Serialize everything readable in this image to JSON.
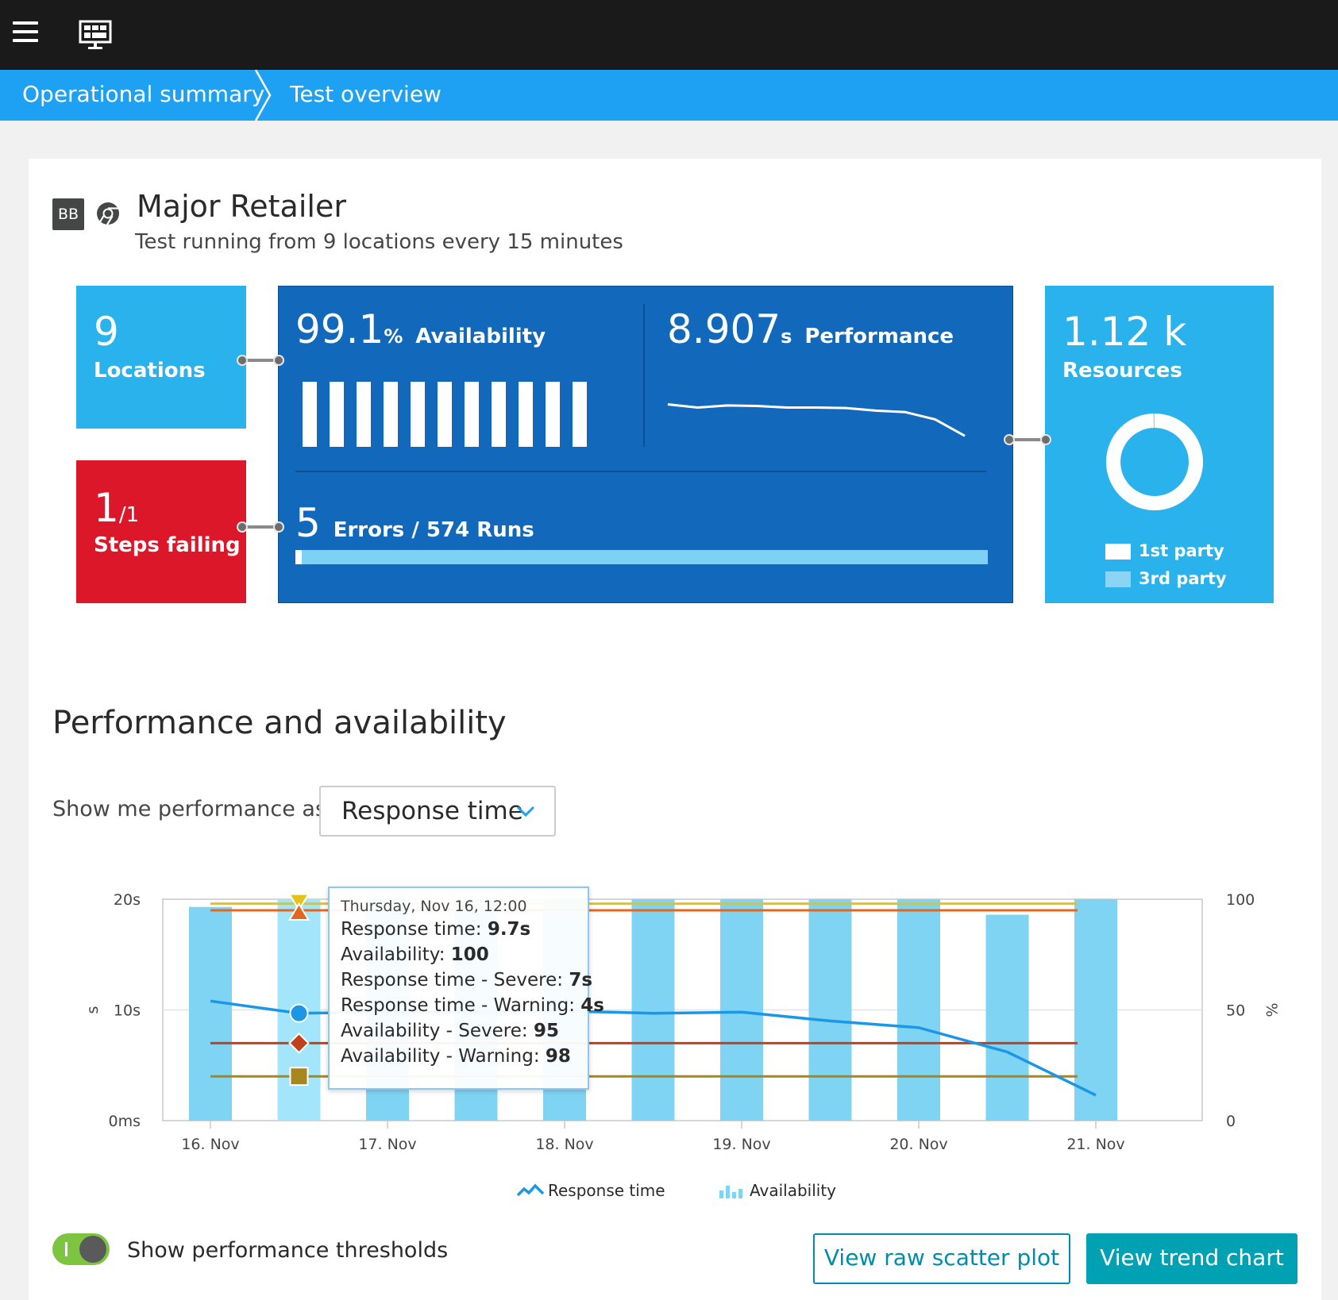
{
  "colors": {
    "topbar": "#1a1a1a",
    "breadcrumb": "#1ea1f2",
    "tile_light": "#2ab2ec",
    "tile_dark": "#1268ba",
    "tile_error": "#dc172a",
    "chart_bar": "#7fd3f3",
    "response_line": "#1c96e6",
    "severe_line": "#c0411b",
    "warning_line": "#a6861d",
    "avail_severe_line": "#e5671f",
    "avail_warning_line": "#e3c31a",
    "button": "#00a1b2"
  },
  "nav": {
    "menu_icon": "hamburger-menu-icon",
    "monitor_icon": "monitor-dashboard-icon",
    "breadcrumb": [
      "Operational summary",
      "Test overview"
    ]
  },
  "test": {
    "badge": "BB",
    "browser_icon": "chrome-icon",
    "title": "Major Retailer",
    "subtitle": "Test running from 9 locations every 15 minutes"
  },
  "tiles": {
    "locations": {
      "value": "9",
      "label": "Locations"
    },
    "steps": {
      "value": "1",
      "total": "/1",
      "label": "Steps failing"
    },
    "availability": {
      "value": "99.1",
      "unit": "%",
      "label": "Availability",
      "bars": 11
    },
    "performance": {
      "value": "8.907",
      "unit": "s",
      "label": "Performance",
      "spark": [
        12.3,
        11.7,
        12.1,
        12.0,
        11.7,
        11.7,
        11.6,
        11.1,
        10.8,
        9.4,
        6.2
      ]
    },
    "errors": {
      "value": "5",
      "label": "Errors / 574 Runs",
      "errors": 5,
      "runs": 574
    },
    "resources": {
      "value": "1.12 k",
      "label": "Resources",
      "first_party_share": 0.995,
      "legend": [
        "1st party",
        "3rd party"
      ]
    }
  },
  "section": {
    "title": "Performance and availability",
    "show_label": "Show me performance as",
    "select_value": "Response time"
  },
  "chart_data": {
    "type": "bar",
    "x": [
      "16. Nov",
      "17. Nov",
      "18. Nov",
      "19. Nov",
      "20. Nov",
      "21. Nov"
    ],
    "x_ticks": [
      "16. Nov",
      "17. Nov",
      "18. Nov",
      "19. Nov",
      "20. Nov",
      "21. Nov"
    ],
    "ylabel": "s",
    "ylabel_right": "%",
    "y_ticks": [
      "20s",
      "10s",
      "0ms"
    ],
    "y_right_ticks": [
      "100",
      "50",
      "0"
    ],
    "ylim": [
      0,
      20
    ],
    "ylim_right": [
      0,
      100
    ],
    "availability": [
      96.5,
      100,
      100,
      100,
      100,
      100,
      100,
      100,
      100,
      93,
      100
    ],
    "response_time": [
      10.8,
      9.7,
      9.8,
      9.8,
      9.9,
      9.7,
      9.8,
      9.0,
      8.4,
      6.2,
      2.3
    ],
    "thresholds": {
      "response_severe": 7,
      "response_warning": 4,
      "availability_severe": 95,
      "availability_warning": 98
    },
    "legend": [
      "Response time",
      "Availability"
    ],
    "legend_icons": [
      "line-chart-icon",
      "bar-chart-icon"
    ]
  },
  "tooltip": {
    "date": "Thursday, Nov 16, 12:00",
    "rows": [
      {
        "label": "Response time: ",
        "value": "9.7s"
      },
      {
        "label": "Availability: ",
        "value": "100"
      },
      {
        "label": "Response time - Severe: ",
        "value": "7s"
      },
      {
        "label": "Response time - Warning: ",
        "value": "4s"
      },
      {
        "label": "Availability - Severe: ",
        "value": "95"
      },
      {
        "label": "Availability - Warning: ",
        "value": "98"
      }
    ]
  },
  "footer": {
    "toggle_label": "Show performance thresholds",
    "toggle_on": true,
    "scatter_button": "View raw scatter plot",
    "trend_button": "View trend chart"
  }
}
